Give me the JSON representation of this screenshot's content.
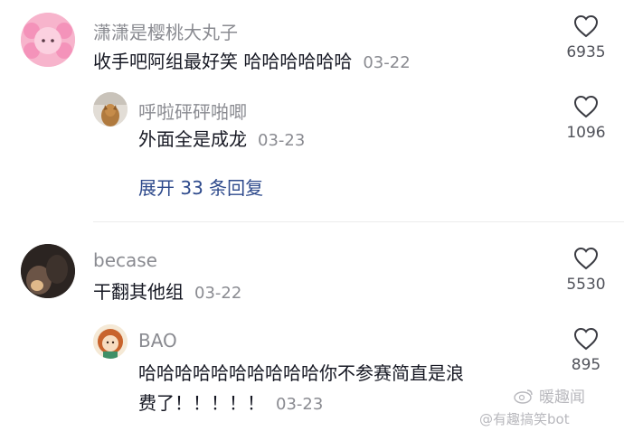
{
  "comments": [
    {
      "username": "潇潇是樱桃大丸子",
      "text": "收手吧阿组最好笑 哈哈哈哈哈哈",
      "date": "03-22",
      "likes": "6935",
      "reply": {
        "username": "呼啦砰砰啪唧",
        "text": "外面全是成龙",
        "date": "03-23",
        "likes": "1096"
      },
      "expand_label": "展开 33 条回复"
    },
    {
      "username": "becase",
      "text": "干翻其他组",
      "date": "03-22",
      "likes": "5530",
      "reply": {
        "username": "BAO",
        "text_line1": "哈哈哈哈哈哈哈哈哈哈你不参赛简直是浪",
        "text_line2": "费了！！！！！",
        "date": "03-23",
        "likes": "895"
      }
    }
  ],
  "avatar_glyph": "··",
  "watermark": {
    "line1": "暖趣闻",
    "line2": "@有趣搞笑bot"
  },
  "colors": {
    "username": "#8a8b91",
    "text": "#161823",
    "link": "#2e4a8c",
    "avatar_pink": "#f59fbf"
  }
}
